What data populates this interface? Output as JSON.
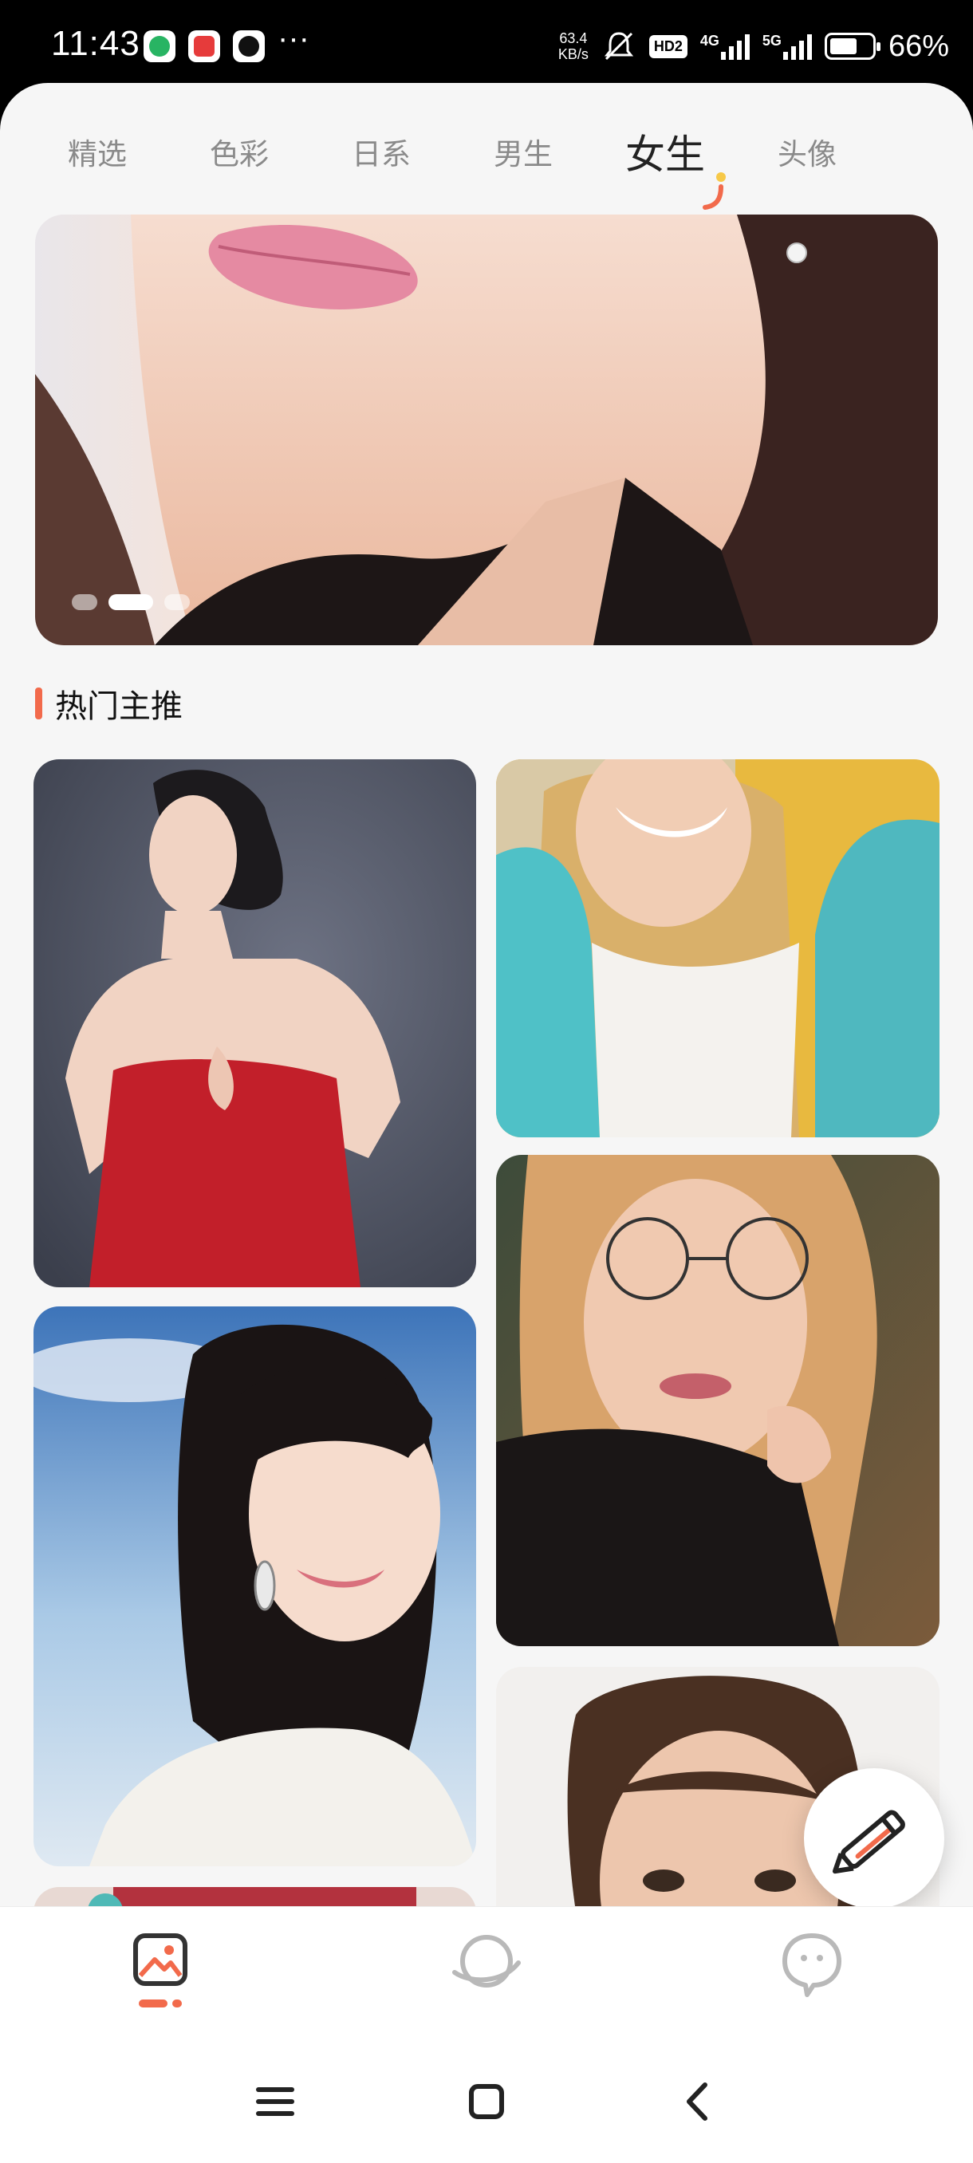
{
  "status_bar": {
    "time": "11:43",
    "more": "···",
    "speed_value": "63.4",
    "speed_unit": "KB/s",
    "hd_label": "HD2",
    "net1": "4G",
    "net2": "5G",
    "battery_percent": "66%",
    "battery_level": 0.66
  },
  "tabs": [
    {
      "label": "精选",
      "active": false
    },
    {
      "label": "色彩",
      "active": false
    },
    {
      "label": "日系",
      "active": false
    },
    {
      "label": "男生",
      "active": false
    },
    {
      "label": "女生",
      "active": true
    },
    {
      "label": "头像",
      "active": false
    }
  ],
  "banner": {
    "slide_count": 3,
    "active_slide": 2
  },
  "section": {
    "title": "热门主推"
  },
  "colors": {
    "accent": "#f26a4b",
    "tab_mark_orange": "#f26a4b",
    "tab_mark_yellow": "#f7c948"
  },
  "bottom_nav": [
    {
      "icon": "gallery-icon",
      "active": true
    },
    {
      "icon": "planet-icon",
      "active": false
    },
    {
      "icon": "chat-bubble-icon",
      "active": false
    }
  ],
  "system_nav": [
    "menu-icon",
    "home-icon",
    "back-icon"
  ]
}
